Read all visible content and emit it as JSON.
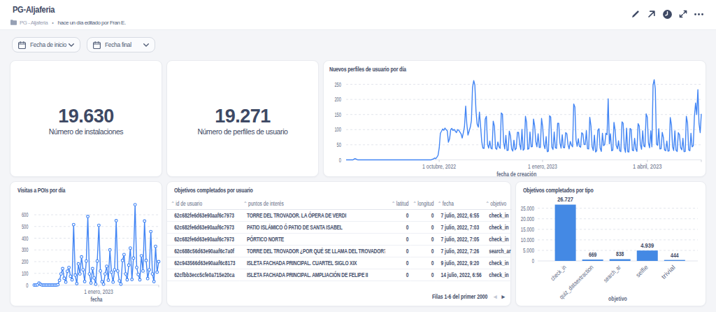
{
  "header": {
    "title": "PG-Aljaferia",
    "breadcrumb": {
      "path": "PG - Aljaferia",
      "separator": "•",
      "edited": "hace un día editado por Fran E."
    },
    "toolbar": {
      "icons": [
        "edit-pencil",
        "open-in-new-arrow",
        "refresh-clock",
        "fullscreen-expand",
        "more-options"
      ]
    }
  },
  "filters": [
    {
      "label": "Fecha de inicio"
    },
    {
      "label": "Fecha final"
    }
  ],
  "scorecards": [
    {
      "value": "19.630",
      "label": "Número de instalaciones"
    },
    {
      "value": "19.271",
      "label": "Número de perfiles de usuario"
    }
  ],
  "colors": {
    "accent_line": "#4285f4",
    "accent_bar": "#4489e4",
    "navy_text": "#3e4964",
    "axis_text": "#5f6b85",
    "grid": "#e2e5ec",
    "page_bg": "#f4f5f8",
    "card_bg": "#ffffff"
  },
  "chart_data": [
    {
      "id": "new-profiles",
      "type": "line",
      "title": "Nuevos perfiles de usuario por día",
      "xlabel": "fecha de creación",
      "ylabel": "",
      "ylim": [
        0,
        250
      ],
      "yticks": [
        0,
        50,
        100,
        150,
        200,
        250
      ],
      "xticks": [
        {
          "label": "1 octubre, 2022",
          "f": 0.262
        },
        {
          "label": "1 enero, 2023",
          "f": 0.553
        },
        {
          "label": "1 abril, 2023",
          "f": 0.848
        }
      ],
      "markers": false,
      "values": [
        0,
        0,
        0,
        0,
        0,
        0,
        0,
        3,
        4,
        2,
        0,
        0,
        0,
        0,
        0,
        0,
        0,
        0,
        0,
        0,
        0,
        0,
        0,
        0,
        0,
        0,
        0,
        0,
        0,
        0,
        0,
        0,
        0,
        0,
        0,
        0,
        0,
        0,
        0,
        0,
        0,
        0,
        0,
        0,
        0,
        0,
        0,
        0,
        0,
        0,
        0,
        0,
        0,
        0,
        0,
        0,
        0,
        0,
        0,
        0,
        0,
        0,
        0,
        0,
        0,
        0,
        0,
        0,
        0,
        0,
        0,
        0,
        0,
        0,
        0,
        2,
        3,
        6,
        4,
        9,
        15,
        40,
        88,
        95,
        102,
        98,
        105,
        100,
        96,
        58,
        70,
        100,
        104,
        97,
        101,
        95,
        90,
        100,
        98,
        92,
        86,
        72,
        90,
        110,
        178,
        120,
        82,
        95,
        108,
        130,
        240,
        262,
        248,
        160,
        118,
        108,
        158,
        112,
        60,
        39,
        38,
        134,
        144,
        52,
        39,
        62,
        39,
        36,
        128,
        112,
        39,
        35,
        59,
        43,
        38,
        155,
        151,
        59,
        36,
        81,
        31,
        32,
        95,
        79,
        36,
        29,
        65,
        33,
        38,
        91,
        91,
        52,
        34,
        101,
        32,
        36,
        144,
        124,
        35,
        37,
        92,
        43,
        44,
        135,
        113,
        60,
        43,
        86,
        41,
        41,
        137,
        110,
        50,
        37,
        77,
        27,
        29,
        146,
        142,
        42,
        34,
        92,
        40,
        38,
        121,
        121,
        56,
        39,
        83,
        41,
        40,
        90,
        86,
        50,
        36,
        61,
        49,
        43,
        185,
        175,
        66,
        45,
        70,
        45,
        42,
        90,
        85,
        51,
        51,
        97,
        37,
        36,
        141,
        112,
        44,
        31,
        82,
        26,
        30,
        98,
        103,
        39,
        28,
        88,
        47,
        51,
        88,
        83,
        202,
        53,
        86,
        30,
        32,
        124,
        98,
        48,
        36,
        63,
        30,
        27,
        126,
        121,
        41,
        25,
        105,
        27,
        26,
        104,
        100,
        32,
        30,
        71,
        36,
        28,
        120,
        112,
        50,
        35,
        96,
        46,
        43,
        152,
        142,
        56,
        40,
        96,
        43,
        248,
        265,
        235,
        52,
        48,
        103,
        36,
        37,
        91,
        75,
        33,
        30,
        62,
        29,
        30,
        140,
        116,
        43,
        31,
        96,
        32,
        28,
        90,
        83,
        40,
        33,
        71,
        27,
        28,
        144,
        122,
        33,
        30,
        88,
        43,
        47,
        143,
        188,
        150,
        232,
        120,
        90,
        152
      ]
    },
    {
      "id": "poi-visits",
      "type": "line",
      "title": "Visitas a POIs por día",
      "xlabel": "fecha",
      "ylabel": "",
      "ylim": [
        0,
        600
      ],
      "yticks": [
        0,
        100,
        200,
        300,
        400,
        500,
        600
      ],
      "xticks": [
        {
          "label": "1 enero, 2023",
          "f": 0.517
        }
      ],
      "markers": true,
      "values": [
        0,
        0,
        2,
        16,
        6,
        0,
        0,
        0,
        0,
        0,
        0,
        0,
        0,
        0,
        0,
        3,
        40,
        95,
        140,
        58,
        25,
        118,
        150,
        75,
        45,
        516,
        85,
        12,
        180,
        95,
        240,
        130,
        30,
        205,
        585,
        95,
        18,
        140,
        60,
        8,
        205,
        510,
        120,
        28,
        8,
        95,
        160,
        42,
        300,
        110,
        25,
        130,
        549,
        120,
        35,
        8,
        210,
        260,
        95,
        45,
        170,
        315,
        48,
        230,
        686,
        150,
        90,
        45,
        250,
        120,
        546,
        210,
        55,
        130,
        456,
        95,
        30,
        330,
        110,
        200
      ]
    },
    {
      "id": "objectives-by-type",
      "type": "bar",
      "title": "Objetivos completados por tipo",
      "xlabel": "objetivo",
      "ylabel": "",
      "ylim": [
        0,
        25000
      ],
      "yticks": [
        0,
        5000,
        10000,
        15000,
        20000,
        25000
      ],
      "ytick_labels": [
        "0",
        "5.000",
        "10.000",
        "15.000",
        "20.000",
        "25.000"
      ],
      "categories": [
        "check_in",
        "quiz_dataextraction",
        "search_ar",
        "selfie",
        "trivial"
      ],
      "values": [
        26727,
        669,
        838,
        4939,
        444
      ],
      "value_labels": [
        "26.727",
        "669",
        "838",
        "4.939",
        "444"
      ]
    }
  ],
  "table": {
    "title": "Objetivos completados por usuario",
    "columns": [
      {
        "label": "id de usuario",
        "align": "left"
      },
      {
        "label": "puntos de interés",
        "align": "left"
      },
      {
        "label": "latitud",
        "align": "right"
      },
      {
        "label": "longitud",
        "align": "right"
      },
      {
        "label": "fecha",
        "align": "left"
      },
      {
        "label": "objetivo",
        "align": "left"
      }
    ],
    "rows": [
      [
        "62c682fe6d63e90aaf6c7973",
        "TORRE DEL TROVADOR. LA ÓPERA DE VERDI",
        "0",
        "0",
        "7 julio, 2022, 6:55",
        "check_in"
      ],
      [
        "62c682fe6d63e90aaf6c7973",
        "PATIO ISLÁMICO Ó PATIO DE SANTA ISABEL",
        "0",
        "0",
        "7 julio, 2022, 7:03",
        "check_in"
      ],
      [
        "62c682fe6d63e90aaf6c7973",
        "PÓRTICO NORTE",
        "0",
        "0",
        "7 julio, 2022, 7:05",
        "check_in"
      ],
      [
        "62c688c56d63e90aaf6c7a0f",
        "TORRE DEL TROVADOR ¿POR QUÉ SE LLAMA DEL TROVADOR?",
        "0",
        "0",
        "7 julio, 2022, 7:26",
        "search_ar"
      ],
      [
        "62c943566d63e90aaf6c8173",
        "ISLETA FACHADA PRINCIPAL. CUARTEL SIGLO XIX",
        "0",
        "0",
        "9 julio, 2022, 9:20",
        "check_in"
      ],
      [
        "62cfbb3ecc5cfe0a715e20ca",
        "ISLETA FACHADA PRINCIPAL. AMPLIACIÓN DE FELIPE II",
        "0",
        "0",
        "14 julio, 2022, 6:56",
        "check_in"
      ]
    ],
    "footer": {
      "text": "Filas 1-6 del primer 2000",
      "prev": "◂",
      "next": "▸"
    }
  }
}
